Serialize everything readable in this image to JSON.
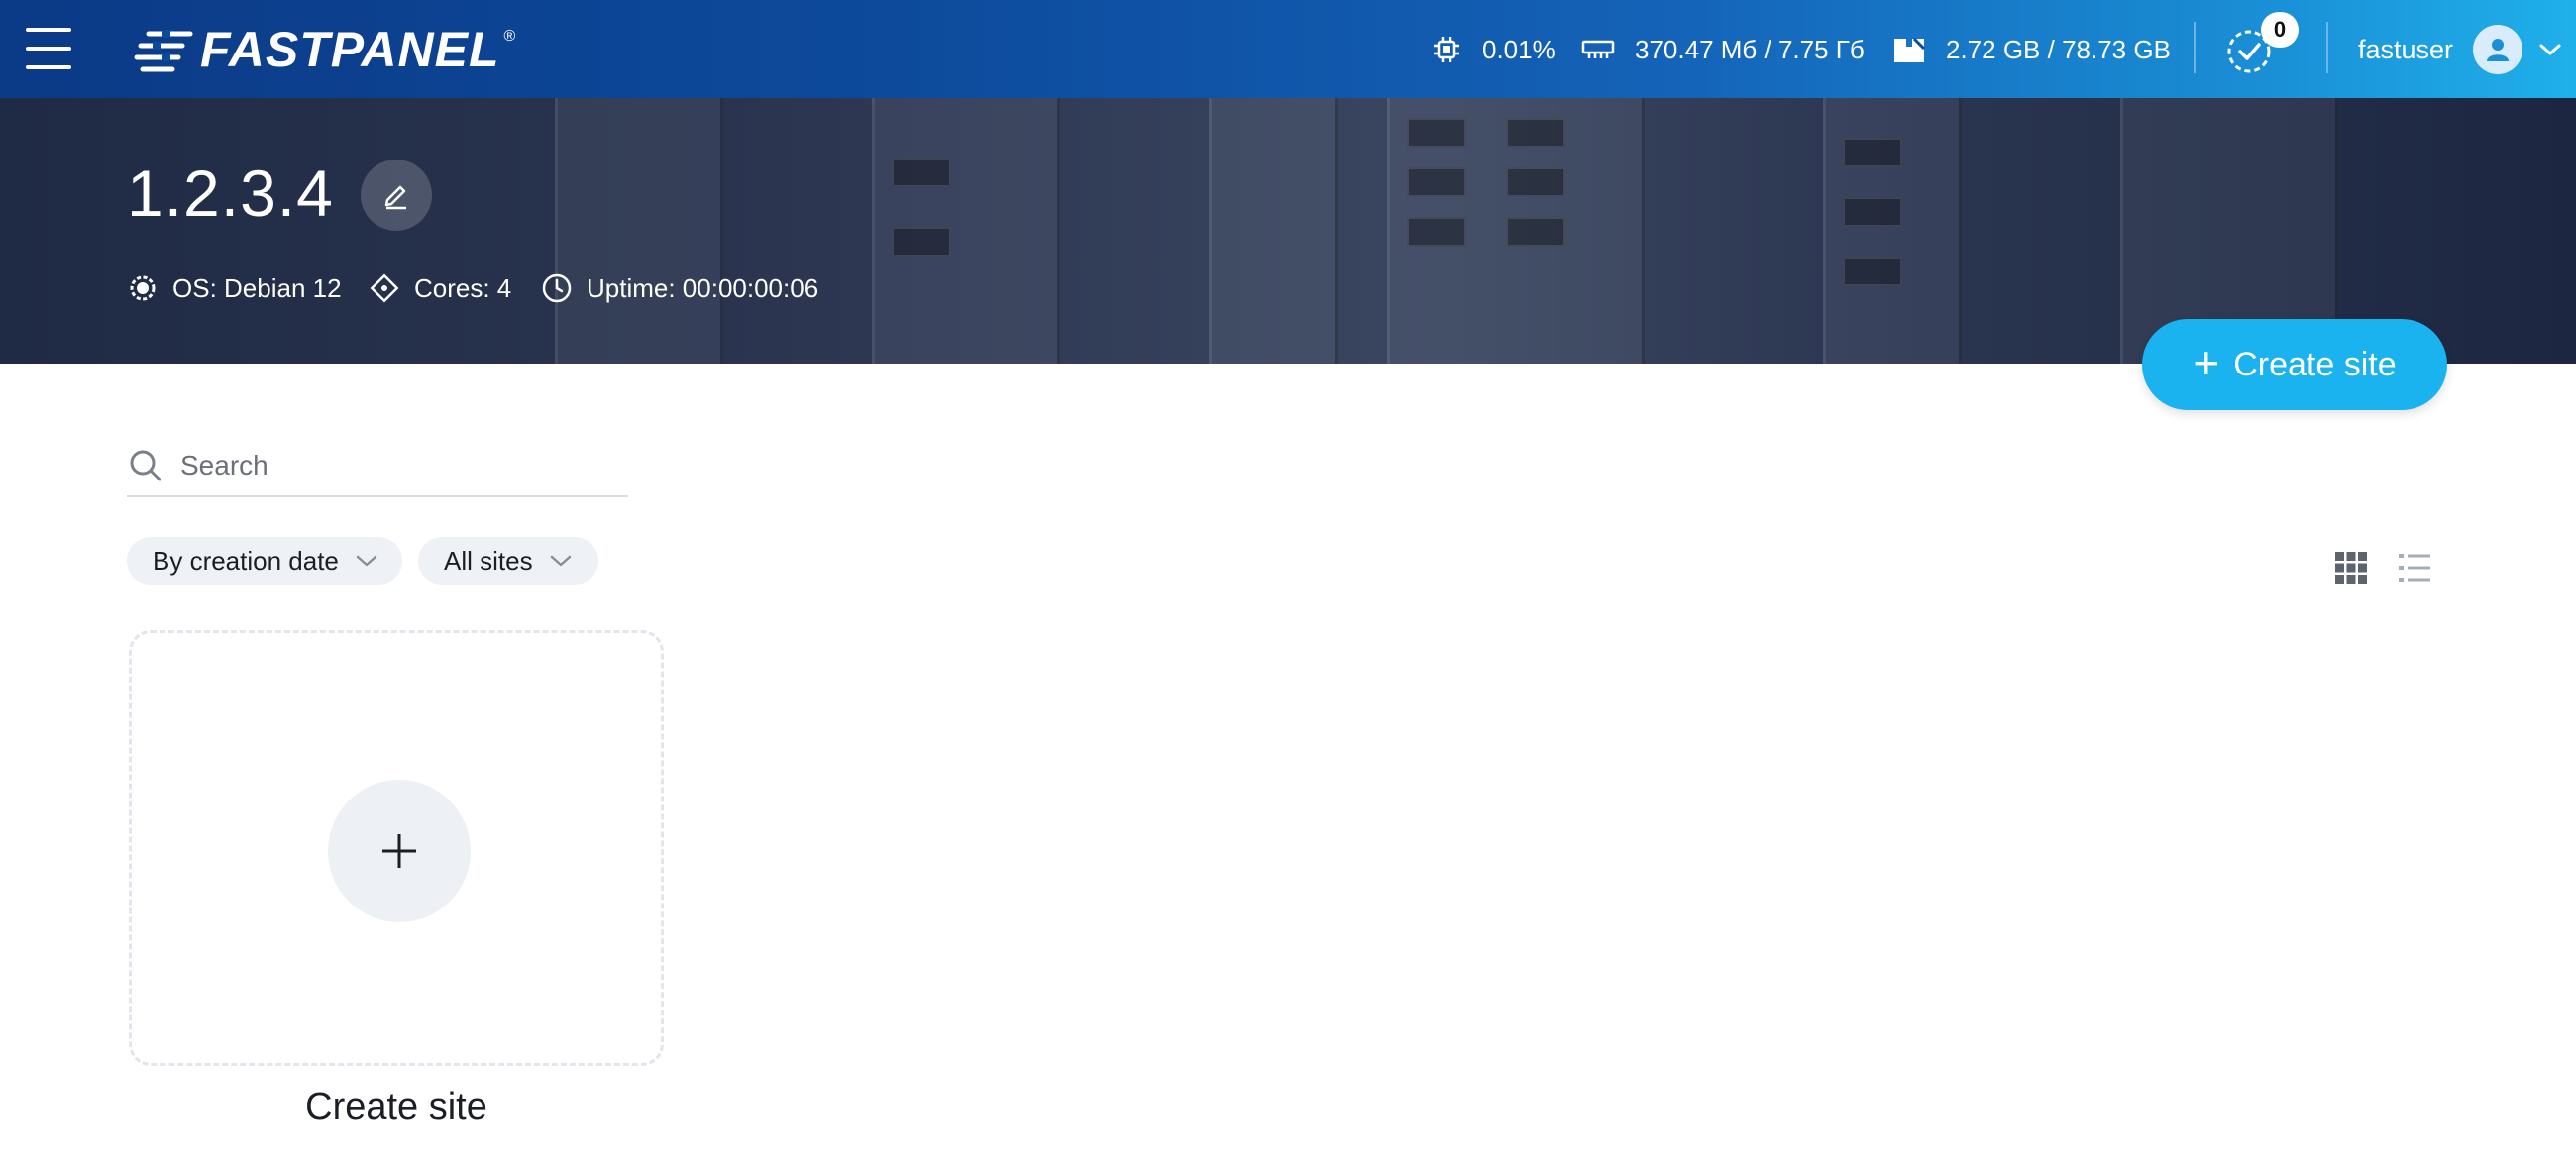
{
  "topbar": {
    "logo_text": "FASTPANEL",
    "logo_reg": "®",
    "cpu": "0.01%",
    "ram": "370.47 Мб / 7.75 Гб",
    "disk": "2.72 GB / 78.73 GB",
    "tasks_count": "0",
    "username": "fastuser"
  },
  "hero": {
    "server_name": "1.2.3.4",
    "os": "OS: Debian 12",
    "cores": "Cores: 4",
    "uptime": "Uptime: 00:00:00:06"
  },
  "actions": {
    "create_site": "Create site"
  },
  "search": {
    "placeholder": "Search"
  },
  "filters": {
    "sort": "By creation date",
    "scope": "All sites"
  },
  "create_card": {
    "label": "Create site"
  },
  "icons": {
    "menu": "hamburger-icon",
    "cpu": "cpu-icon",
    "ram": "memory-icon",
    "disk": "disk-icon",
    "tasks": "tasks-check-icon",
    "user": "user-avatar-icon",
    "edit": "pencil-icon",
    "os": "gear-icon",
    "cores": "diamond-icon",
    "uptime": "clock-icon",
    "search": "search-icon",
    "grid_view": "grid-view-icon",
    "list_view": "list-view-icon",
    "plus": "plus-icon"
  },
  "colors": {
    "accent": "#1ab2ef",
    "topbar_start": "#0b3a86",
    "topbar_end": "#1fb0ea"
  }
}
